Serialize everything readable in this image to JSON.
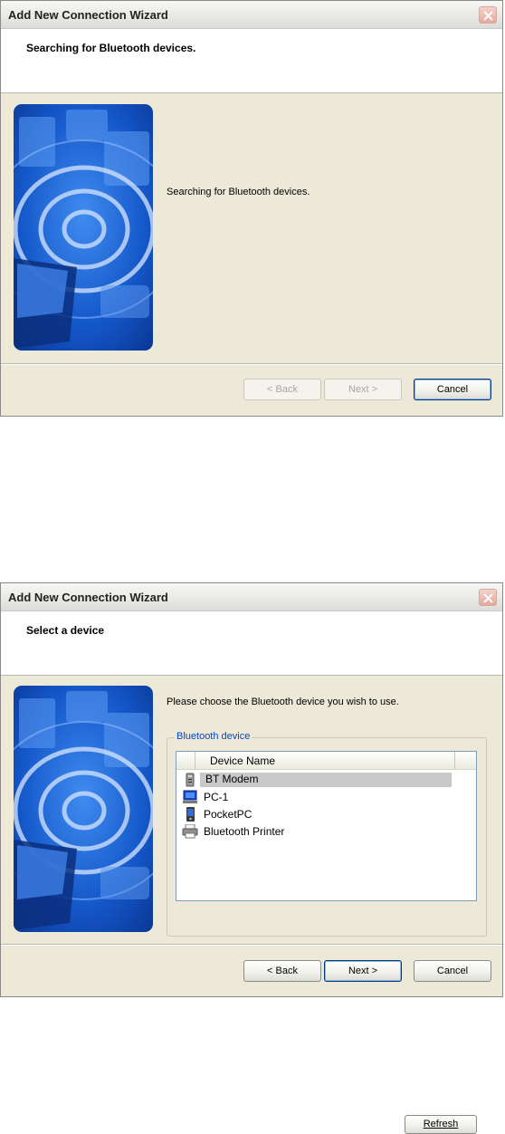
{
  "window1": {
    "title": "Add New Connection Wizard",
    "header_title": "Searching for Bluetooth devices.",
    "message": "Searching for Bluetooth devices.",
    "buttons": {
      "back": "< Back",
      "next": "Next >",
      "cancel": "Cancel"
    }
  },
  "window2": {
    "title": "Add New Connection Wizard",
    "header_title": "Select a device",
    "prompt": "Please choose the Bluetooth device you wish to use.",
    "group_label": "Bluetooth device",
    "column_header": "Device Name",
    "devices": [
      {
        "name": "BT Modem",
        "icon": "modem-icon",
        "selected": true
      },
      {
        "name": "PC-1",
        "icon": "computer-icon",
        "selected": false
      },
      {
        "name": "PocketPC",
        "icon": "pda-icon",
        "selected": false
      },
      {
        "name": "Bluetooth Printer",
        "icon": "printer-icon",
        "selected": false
      }
    ],
    "refresh_button": "Refresh",
    "buttons": {
      "back": "< Back",
      "next": "Next >",
      "cancel": "Cancel"
    }
  },
  "colors": {
    "dialog_background": "#ece9d8",
    "group_label": "#0046d5",
    "art_primary": "#1a5fd0",
    "selection": "#c9c9c9"
  }
}
